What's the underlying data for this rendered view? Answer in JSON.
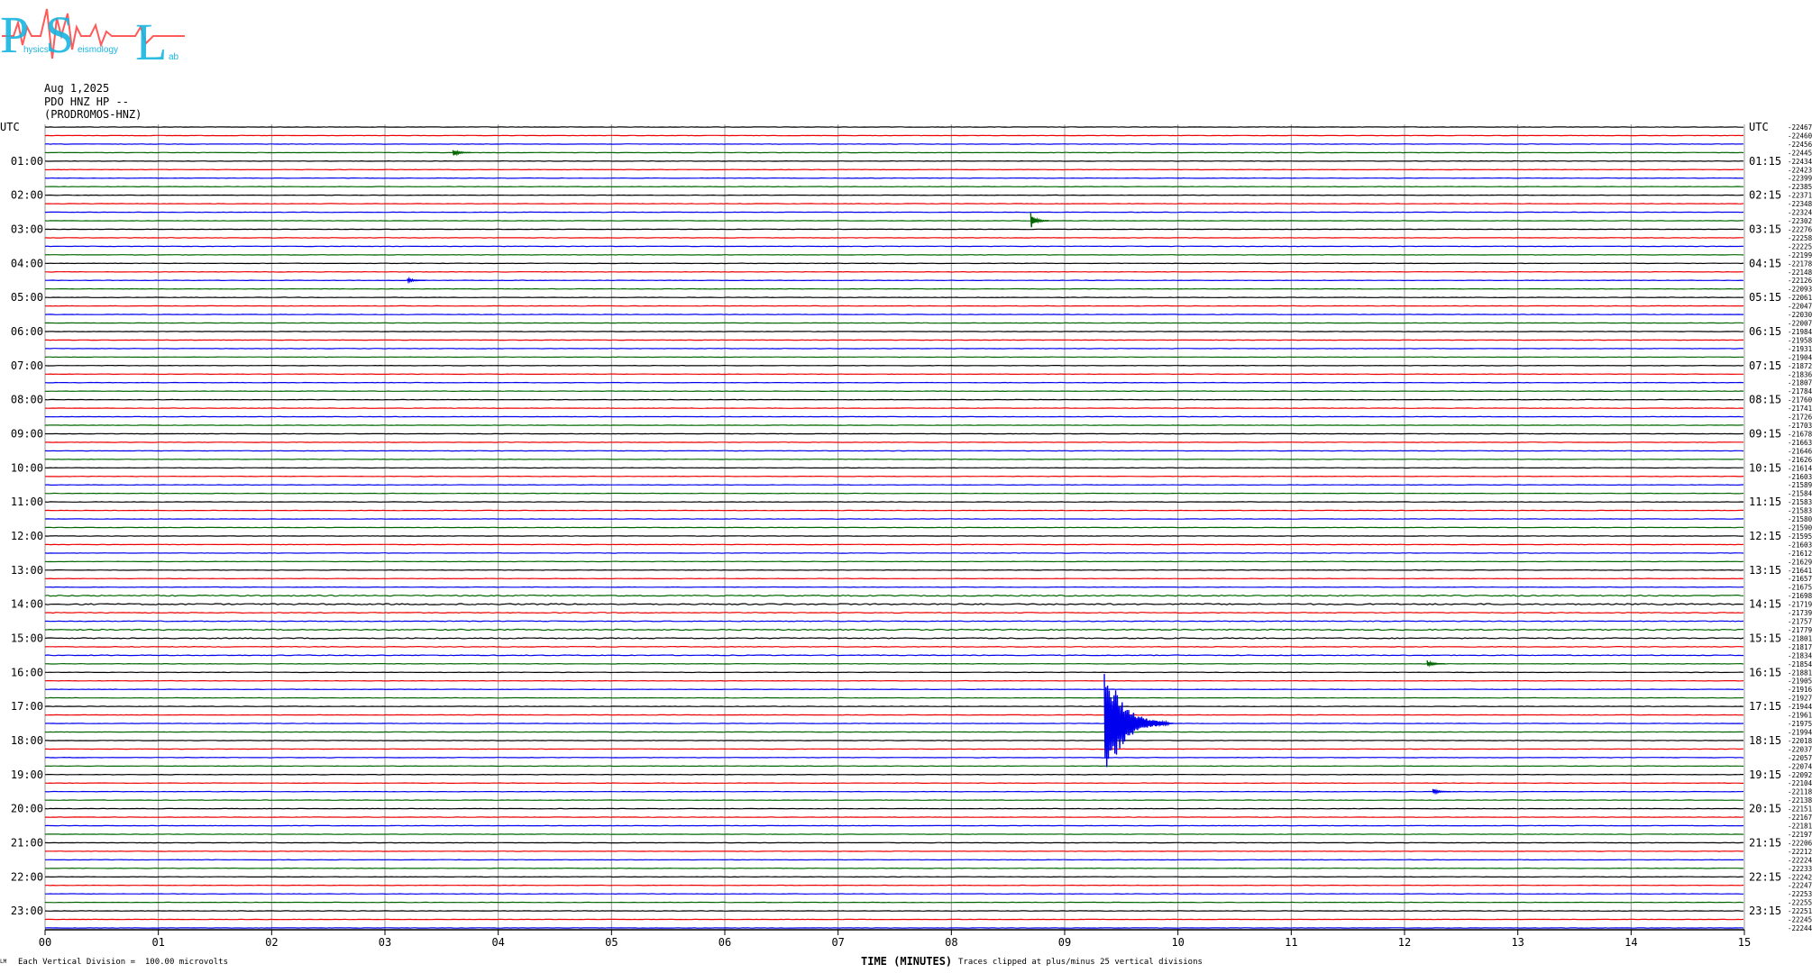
{
  "logo": {
    "big_letters": [
      "P",
      "S",
      "L"
    ],
    "small_words": [
      "hysics",
      "eismology",
      "ab"
    ]
  },
  "header": {
    "date": "Aug 1,2025",
    "station": "PDO HNZ HP --",
    "site": "(PRODROMOS-HNZ)"
  },
  "footer": {
    "left_mark": "LM",
    "vertical_division": "Each Vertical Division =  100.00 microvolts",
    "clip_note": "Traces clipped at plus/minus 25 vertical divisions"
  },
  "colors": {
    "trace_cycle": [
      "#000000",
      "#ee0000",
      "#0000ee",
      "#006600"
    ],
    "grid": "#999999"
  },
  "chart_data": {
    "type": "line",
    "subtype": "helicorder",
    "xlabel": "TIME (MINUTES)",
    "x_ticks": [
      "00",
      "01",
      "02",
      "03",
      "04",
      "05",
      "06",
      "07",
      "08",
      "09",
      "10",
      "11",
      "12",
      "13",
      "14",
      "15"
    ],
    "xlim": [
      0,
      15
    ],
    "left_axis_title": "UTC",
    "right_axis_title": "UTC",
    "lines_per_hour": 4,
    "hour_labels_left": [
      "01:00",
      "02:00",
      "03:00",
      "04:00",
      "05:00",
      "06:00",
      "07:00",
      "08:00",
      "09:00",
      "10:00",
      "11:00",
      "12:00",
      "13:00",
      "14:00",
      "15:00",
      "16:00",
      "17:00",
      "18:00",
      "19:00",
      "20:00",
      "21:00",
      "22:00",
      "23:00"
    ],
    "hour_labels_right": [
      "01:15",
      "02:15",
      "03:15",
      "04:15",
      "05:15",
      "06:15",
      "07:15",
      "08:15",
      "09:15",
      "10:15",
      "11:15",
      "12:15",
      "13:15",
      "14:15",
      "15:15",
      "16:15",
      "17:15",
      "18:15",
      "19:15",
      "20:15",
      "21:15",
      "22:15",
      "23:15"
    ],
    "line_offsets": [
      -22467,
      -22460,
      -22456,
      -22445,
      -22434,
      -22423,
      -22399,
      -22385,
      -22371,
      -22348,
      -22324,
      -22302,
      -22276,
      -22258,
      -22225,
      -22199,
      -22178,
      -22148,
      -22126,
      -22093,
      -22061,
      -22047,
      -22030,
      -22007,
      -21984,
      -21958,
      -21931,
      -21904,
      -21872,
      -21836,
      -21807,
      -21784,
      -21760,
      -21741,
      -21726,
      -21703,
      -21678,
      -21663,
      -21646,
      -21626,
      -21614,
      -21603,
      -21589,
      -21584,
      -21583,
      -21583,
      -21580,
      -21590,
      -21595,
      -21603,
      -21612,
      -21629,
      -21641,
      -21657,
      -21675,
      -21698,
      -21719,
      -21739,
      -21757,
      -21779,
      -21801,
      -21817,
      -21834,
      -21854,
      -21881,
      -21905,
      -21916,
      -21927,
      -21944,
      -21961,
      -21975,
      -21994,
      -22018,
      -22037,
      -22057,
      -22074,
      -22092,
      -22104,
      -22118,
      -22138,
      -22151,
      -22167,
      -22181,
      -22197,
      -22206,
      -22212,
      -22224,
      -22233,
      -22242,
      -22247,
      -22253,
      -22255,
      -22251,
      -22245,
      -22244
    ],
    "events": [
      {
        "line": 3,
        "minute": 3.6,
        "amplitude_div": 1.5
      },
      {
        "line": 11,
        "minute": 8.7,
        "amplitude_div": 3
      },
      {
        "line": 18,
        "minute": 3.2,
        "amplitude_div": 1
      },
      {
        "line": 63,
        "minute": 12.2,
        "amplitude_div": 1.5
      },
      {
        "line": 70,
        "minute": 9.35,
        "amplitude_div": 25
      },
      {
        "line": 70,
        "minute": 9.8,
        "amplitude_div": 1.5
      },
      {
        "line": 78,
        "minute": 12.25,
        "amplitude_div": 1.2
      }
    ],
    "noisy_lines": [
      {
        "line": 55,
        "level": 1.4
      },
      {
        "line": 56,
        "level": 1.6
      },
      {
        "line": 57,
        "level": 1.0
      },
      {
        "line": 58,
        "level": 0.9
      },
      {
        "line": 59,
        "level": 1.4
      },
      {
        "line": 60,
        "level": 1.2
      },
      {
        "line": 61,
        "level": 0.8
      },
      {
        "line": 62,
        "level": 0.9
      }
    ]
  }
}
